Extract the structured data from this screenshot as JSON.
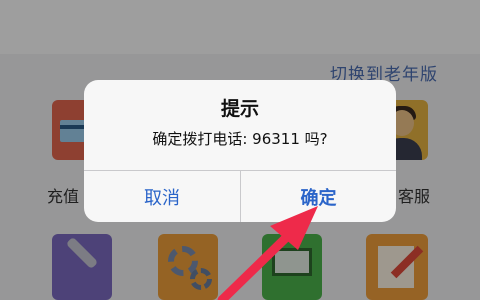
{
  "header": {
    "switch_link": "切换到老年版"
  },
  "grid": {
    "items": [
      {
        "label": "充值",
        "icon": "credit-card-icon"
      },
      {
        "label": "客服",
        "icon": "customer-service-icon"
      }
    ],
    "bottom_icons": [
      "tools-icon",
      "settings-icon",
      "screen-icon",
      "edit-icon"
    ]
  },
  "dialog": {
    "title": "提示",
    "message": "确定拨打电话: 96311 吗?",
    "cancel_label": "取消",
    "confirm_label": "确定"
  },
  "colors": {
    "accent": "#2a64c9",
    "arrow": "#ee2a4a",
    "link": "#4c6fb3"
  }
}
